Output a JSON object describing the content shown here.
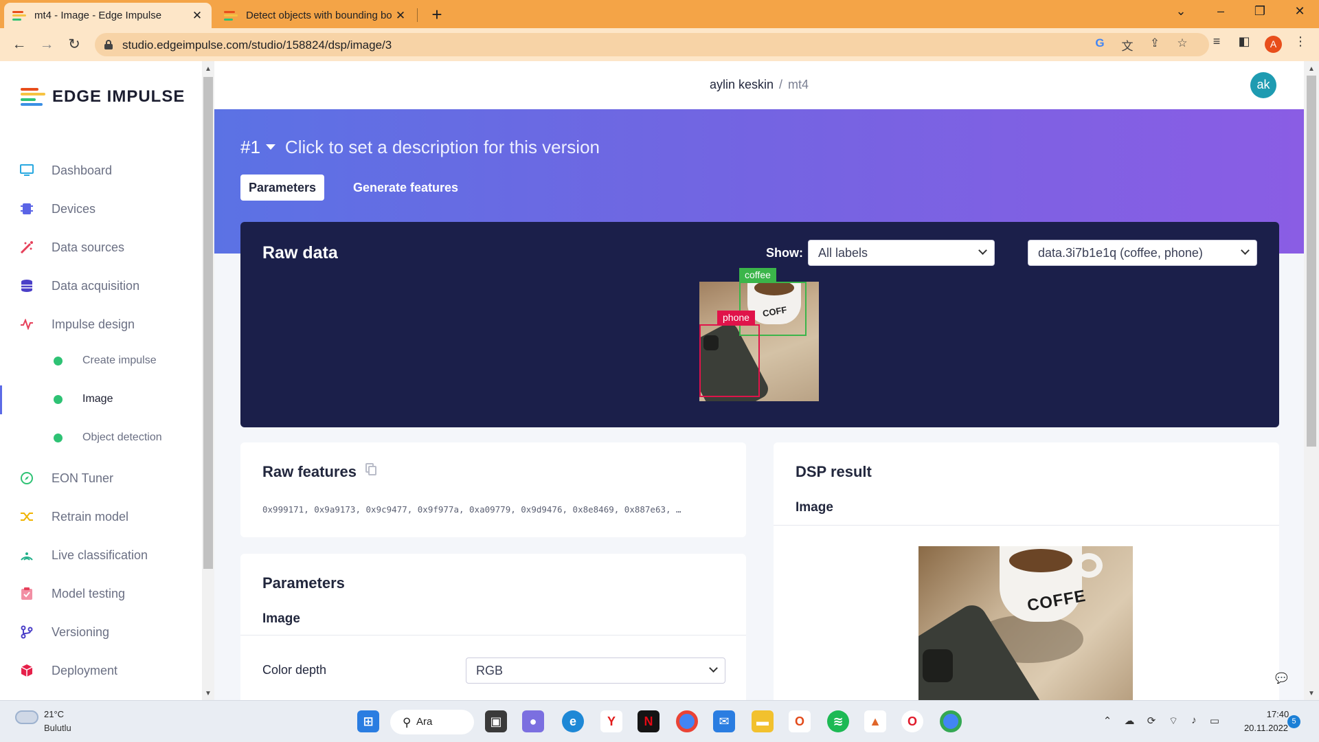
{
  "browser": {
    "tabs": [
      {
        "title": "mt4 - Image - Edge Impulse",
        "active": true
      },
      {
        "title": "Detect objects with bounding bo",
        "active": false
      }
    ],
    "url": "studio.edgeimpulse.com/studio/158824/dsp/image/3",
    "profile_initial": "A"
  },
  "sidebar": {
    "logo": "EDGE IMPULSE",
    "items": [
      {
        "label": "Dashboard",
        "icon": "monitor-icon"
      },
      {
        "label": "Devices",
        "icon": "chip-icon"
      },
      {
        "label": "Data sources",
        "icon": "wand-icon"
      },
      {
        "label": "Data acquisition",
        "icon": "database-icon"
      },
      {
        "label": "Impulse design",
        "icon": "pulse-icon"
      },
      {
        "label": "EON Tuner",
        "icon": "compass-icon"
      },
      {
        "label": "Retrain model",
        "icon": "shuffle-icon"
      },
      {
        "label": "Live classification",
        "icon": "signal-icon"
      },
      {
        "label": "Model testing",
        "icon": "clipboard-check-icon"
      },
      {
        "label": "Versioning",
        "icon": "branch-icon"
      },
      {
        "label": "Deployment",
        "icon": "package-icon"
      }
    ],
    "sub_items": [
      {
        "label": "Create impulse",
        "active": false
      },
      {
        "label": "Image",
        "active": true
      },
      {
        "label": "Object detection",
        "active": false
      }
    ]
  },
  "header": {
    "user": "aylin keskin",
    "separator": "/",
    "project": "mt4",
    "avatar": "ak"
  },
  "hero": {
    "version": "#1",
    "description": "Click to set a description for this version",
    "tabs": [
      "Parameters",
      "Generate features"
    ],
    "active_tab": "Parameters"
  },
  "raw_data": {
    "title": "Raw data",
    "show_label": "Show:",
    "label_filter": "All labels",
    "sample": "data.3i7b1e1q (coffee, phone)",
    "boxes": [
      {
        "label": "coffee",
        "color": "#3bb54a"
      },
      {
        "label": "phone",
        "color": "#e0134a"
      }
    ]
  },
  "raw_features": {
    "title": "Raw features",
    "values": "0x999171, 0x9a9173, 0x9c9477, 0x9f977a, 0xa09779, 0x9d9476, 0x8e8469, 0x887e63, …"
  },
  "parameters": {
    "title": "Parameters",
    "section": "Image",
    "color_depth_label": "Color depth",
    "color_depth_value": "RGB"
  },
  "dsp_result": {
    "title": "DSP result",
    "section": "Image",
    "cup_text": "COFFE"
  },
  "taskbar": {
    "weather_temp": "21°C",
    "weather_desc": "Bulutlu",
    "search": "Ara",
    "time": "17:40",
    "date": "20.11.2022",
    "notifications": "5"
  },
  "colors": {
    "accent": "#5c6ae6",
    "brand_orange": "#f4a447",
    "raw_card_bg": "#1b1f4a",
    "status_green": "#2ec274"
  }
}
